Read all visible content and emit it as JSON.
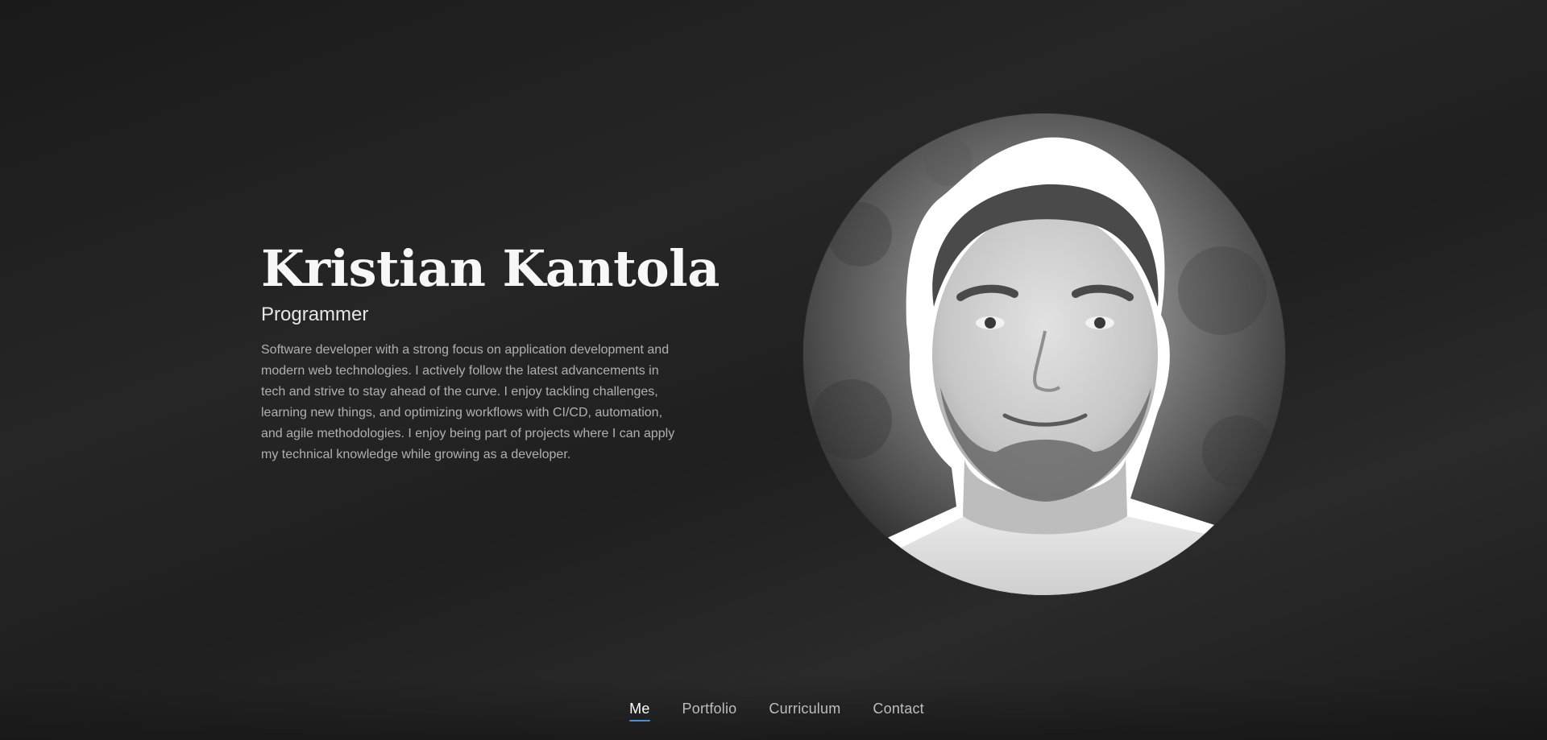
{
  "profile": {
    "name": "Kristian Kantola",
    "role": "Programmer",
    "bio": "Software developer with a strong focus on application development and modern web technologies. I actively follow the latest advancements in tech and strive to stay ahead of the curve. I enjoy tackling challenges, learning new things, and optimizing workflows with CI/CD, automation, and agile methodologies. I enjoy being part of projects where I can apply my technical knowledge while growing as a developer."
  },
  "portrait": {
    "icon": "profile-photo"
  },
  "nav": {
    "items": [
      {
        "label": "Me",
        "active": true
      },
      {
        "label": "Portfolio",
        "active": false
      },
      {
        "label": "Curriculum",
        "active": false
      },
      {
        "label": "Contact",
        "active": false
      }
    ]
  },
  "colors": {
    "background": "#1f1f1f",
    "accent": "#4a90d9",
    "heading": "#f7f7f7",
    "body_text": "#b0b0b0"
  }
}
